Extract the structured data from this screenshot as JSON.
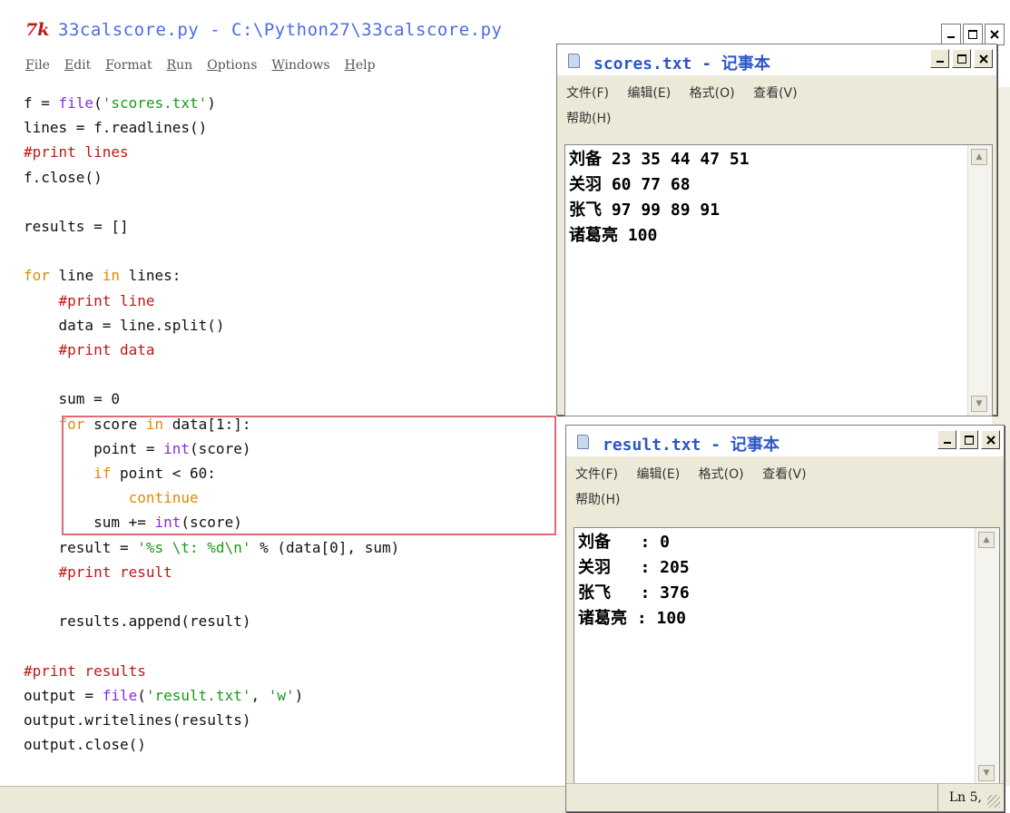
{
  "idle": {
    "logo": "7k",
    "title": "33calscore.py - C:\\Python27\\33calscore.py",
    "menu": [
      "File",
      "Edit",
      "Format",
      "Run",
      "Options",
      "Windows",
      "Help"
    ],
    "code_lines": [
      "f = file('scores.txt')",
      "lines = f.readlines()",
      "#print lines",
      "f.close()",
      "",
      "results = []",
      "",
      "for line in lines:",
      "    #print line",
      "    data = line.split()",
      "    #print data",
      "",
      "    sum = 0",
      "    for score in data[1:]:",
      "        point = int(score)",
      "        if point < 60:",
      "            continue",
      "        sum += int(score)",
      "    result = '%s \\t: %d\\n' % (data[0], sum)",
      "    #print result",
      "",
      "    results.append(result)",
      "",
      "#print results",
      "output = file('result.txt', 'w')",
      "output.writelines(results)",
      "output.close()"
    ]
  },
  "scores_window": {
    "title": "scores.txt - 记事本",
    "menu": [
      "文件(F)",
      "编辑(E)",
      "格式(O)",
      "查看(V)",
      "帮助(H)"
    ],
    "lines": [
      "刘备 23 35 44 47 51",
      "关羽 60 77 68",
      "张飞 97 99 89 91",
      "诸葛亮 100"
    ]
  },
  "result_window": {
    "title": "result.txt - 记事本",
    "menu": [
      "文件(F)",
      "编辑(E)",
      "格式(O)",
      "查看(V)",
      "帮助(H)"
    ],
    "lines": [
      "刘备   : 0",
      "关羽   : 205",
      "张飞   : 376",
      "诸葛亮 : 100"
    ],
    "status": "Ln 5,"
  }
}
